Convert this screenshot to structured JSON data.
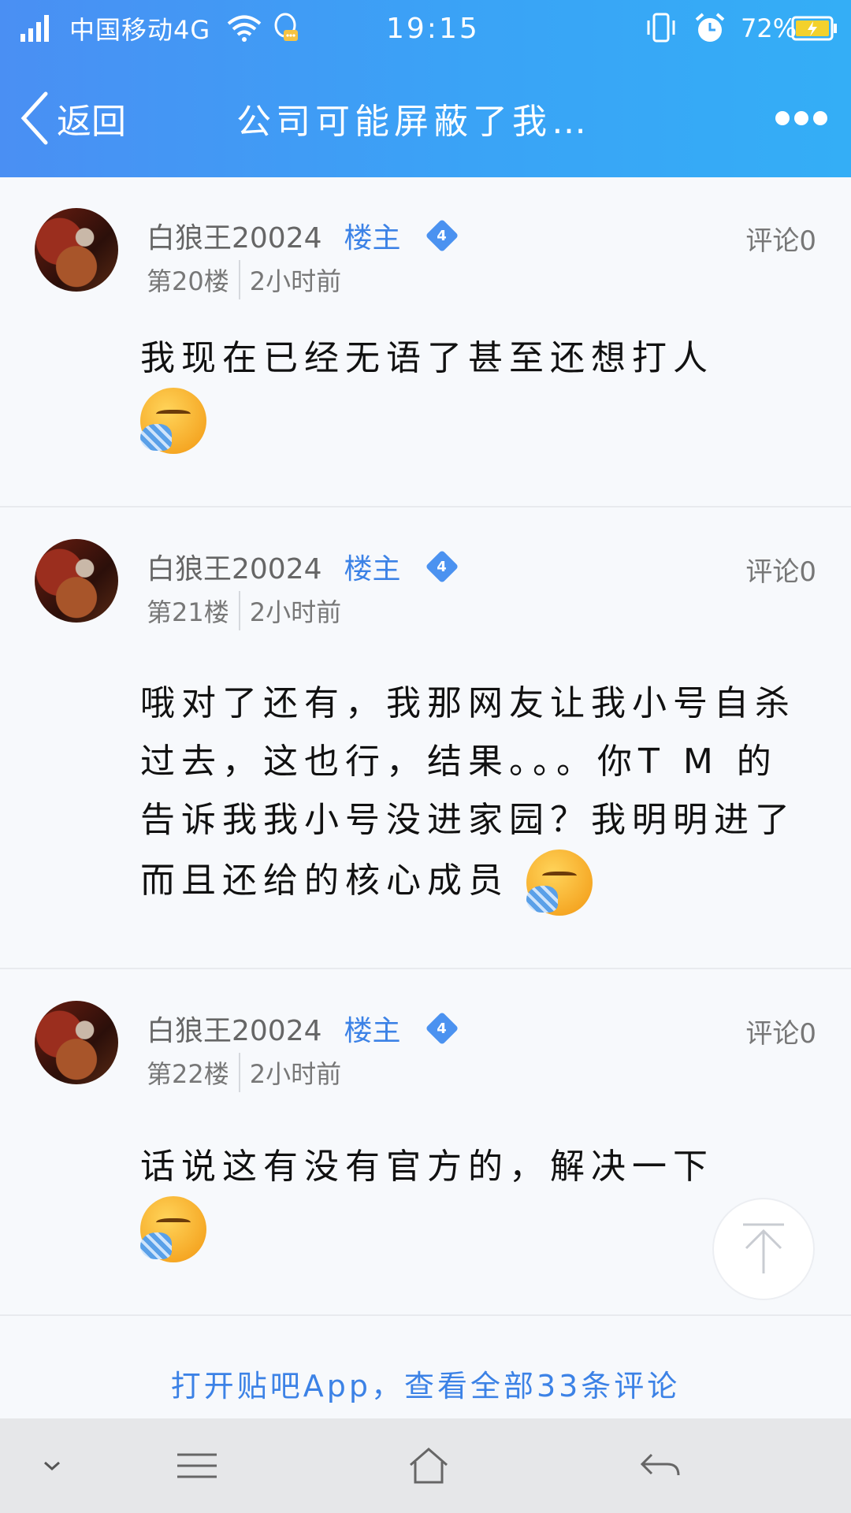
{
  "status_bar": {
    "carrier": "中国移动4G",
    "time": "19:15",
    "battery": "72%"
  },
  "nav": {
    "back_label": "返回",
    "title": "公司可能屏蔽了我…"
  },
  "posts": [
    {
      "author": "白狼王20024",
      "badge": "楼主",
      "level": "4",
      "floor": "第20楼",
      "time": "2小时前",
      "comments": "评论0",
      "text": "我现在已经无语了甚至还想打人"
    },
    {
      "author": "白狼王20024",
      "badge": "楼主",
      "level": "4",
      "floor": "第21楼",
      "time": "2小时前",
      "comments": "评论0",
      "text": "哦对了还有，我那网友让我小号自杀过去，这也行，结果。。。你T M 的告诉我我小号没进家园？我明明进了而且还给的核心成员"
    },
    {
      "author": "白狼王20024",
      "badge": "楼主",
      "level": "4",
      "floor": "第22楼",
      "time": "2小时前",
      "comments": "评论0",
      "text": "话说这有没有官方的，解决一下"
    }
  ],
  "open_app": "打开贴吧App，查看全部33条评论",
  "colors": {
    "header_gradient_start": "#4a8ff3",
    "header_gradient_end": "#34aef6",
    "link_blue": "#3c82e6"
  }
}
